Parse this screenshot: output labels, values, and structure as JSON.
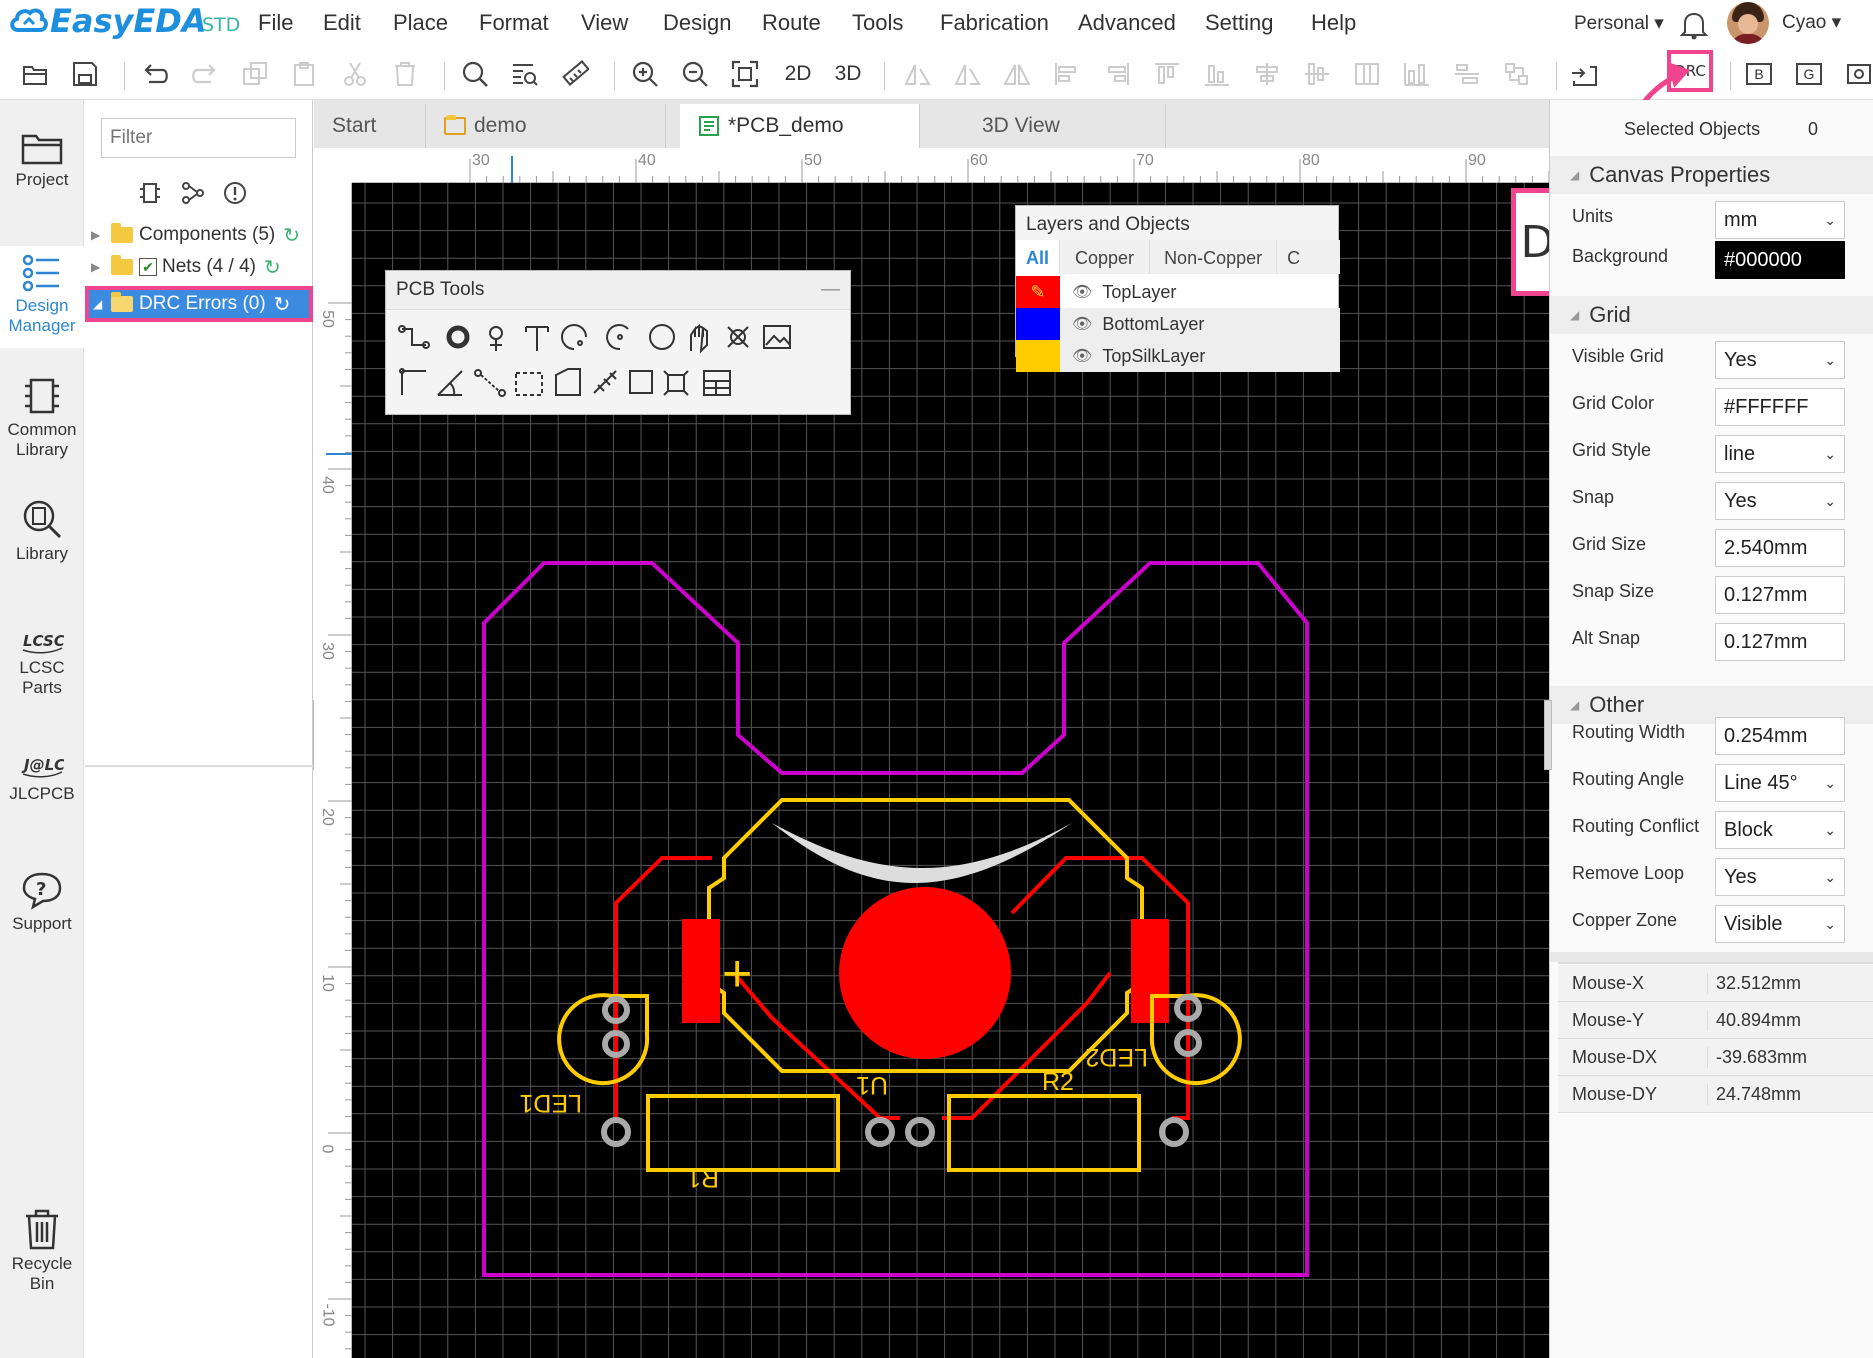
{
  "app": {
    "logo_text": "EasyEDA",
    "logo_suffix": "STD",
    "menu": [
      "File",
      "Edit",
      "Place",
      "Format",
      "View",
      "Design",
      "Route",
      "Tools",
      "Fabrication",
      "Advanced",
      "Setting",
      "Help"
    ],
    "account": "Personal",
    "user": "Cyao",
    "toolbar": {
      "btn_2d": "2D",
      "btn_3d": "3D",
      "drc": "DRC",
      "b": "B",
      "g": "G"
    }
  },
  "left_nav": [
    {
      "label": "Project",
      "icon": "folder-icon"
    },
    {
      "label": "Design Manager",
      "icon": "list-icon"
    },
    {
      "label": "Common Library",
      "icon": "chip-icon"
    },
    {
      "label": "Library",
      "icon": "library-search-icon"
    },
    {
      "label": "LCSC Parts",
      "icon": "lcsc-logo-icon"
    },
    {
      "label": "JLCPCB",
      "icon": "jlc-logo-icon"
    },
    {
      "label": "Support",
      "icon": "help-icon"
    },
    {
      "label": "Recycle Bin",
      "icon": "trash-icon"
    }
  ],
  "design_manager": {
    "filter_placeholder": "Filter",
    "tree": [
      {
        "label": "Components (5)"
      },
      {
        "label": "Nets (4 / 4)"
      },
      {
        "label": "DRC Errors (0)"
      }
    ]
  },
  "tabs": [
    "Start",
    "demo",
    "*PCB_demo",
    "3D View"
  ],
  "ruler": {
    "h_labels": [
      "30",
      "40",
      "50",
      "60",
      "70",
      "80",
      "90"
    ],
    "v_labels": [
      "50",
      "40",
      "30",
      "20",
      "10",
      "0",
      "-10"
    ]
  },
  "pcb_tools": {
    "title": "PCB Tools",
    "minimize": "—"
  },
  "layers_panel": {
    "title": "Layers and Objects",
    "tabs": [
      "All",
      "Copper",
      "Non-Copper",
      "C"
    ],
    "layers": [
      {
        "name": "TopLayer",
        "color": "#ff0000"
      },
      {
        "name": "BottomLayer",
        "color": "#0000ff"
      },
      {
        "name": "TopSilkLayer",
        "color": "#ffcc00"
      }
    ]
  },
  "callout": {
    "text": "DRC"
  },
  "pcb": {
    "labels": {
      "led1": "LED1",
      "led2": "LED2",
      "u1": "U1",
      "r1": "R1",
      "r2": "R2",
      "plus": "+"
    },
    "colors": {
      "outline": "#cc00cc",
      "copper": "#ff0000",
      "silk": "#ffcc00"
    }
  },
  "properties": {
    "selected_label": "Selected Objects",
    "selected_count": "0",
    "canvas_title": "Canvas Properties",
    "units_label": "Units",
    "units_value": "mm",
    "background_label": "Background",
    "background_value": "#000000",
    "grid_title": "Grid",
    "visible_grid_label": "Visible Grid",
    "visible_grid_value": "Yes",
    "grid_color_label": "Grid Color",
    "grid_color_value": "#FFFFFF",
    "grid_style_label": "Grid Style",
    "grid_style_value": "line",
    "snap_label": "Snap",
    "snap_value": "Yes",
    "grid_size_label": "Grid Size",
    "grid_size_value": "2.540mm",
    "snap_size_label": "Snap Size",
    "snap_size_value": "0.127mm",
    "alt_snap_label": "Alt Snap",
    "alt_snap_value": "0.127mm",
    "other_title": "Other",
    "routing_width_label": "Routing Width",
    "routing_width_value": "0.254mm",
    "routing_angle_label": "Routing Angle",
    "routing_angle_value": "Line 45°",
    "routing_conflict_label": "Routing Conflict",
    "routing_conflict_value": "Block",
    "remove_loop_label": "Remove Loop",
    "remove_loop_value": "Yes",
    "copper_zone_label": "Copper Zone",
    "copper_zone_value": "Visible",
    "mouse": [
      {
        "label": "Mouse-X",
        "value": "32.512mm"
      },
      {
        "label": "Mouse-Y",
        "value": "40.894mm"
      },
      {
        "label": "Mouse-DX",
        "value": "-39.683mm"
      },
      {
        "label": "Mouse-DY",
        "value": "24.748mm"
      }
    ]
  },
  "highlight_color": "#f0448f"
}
